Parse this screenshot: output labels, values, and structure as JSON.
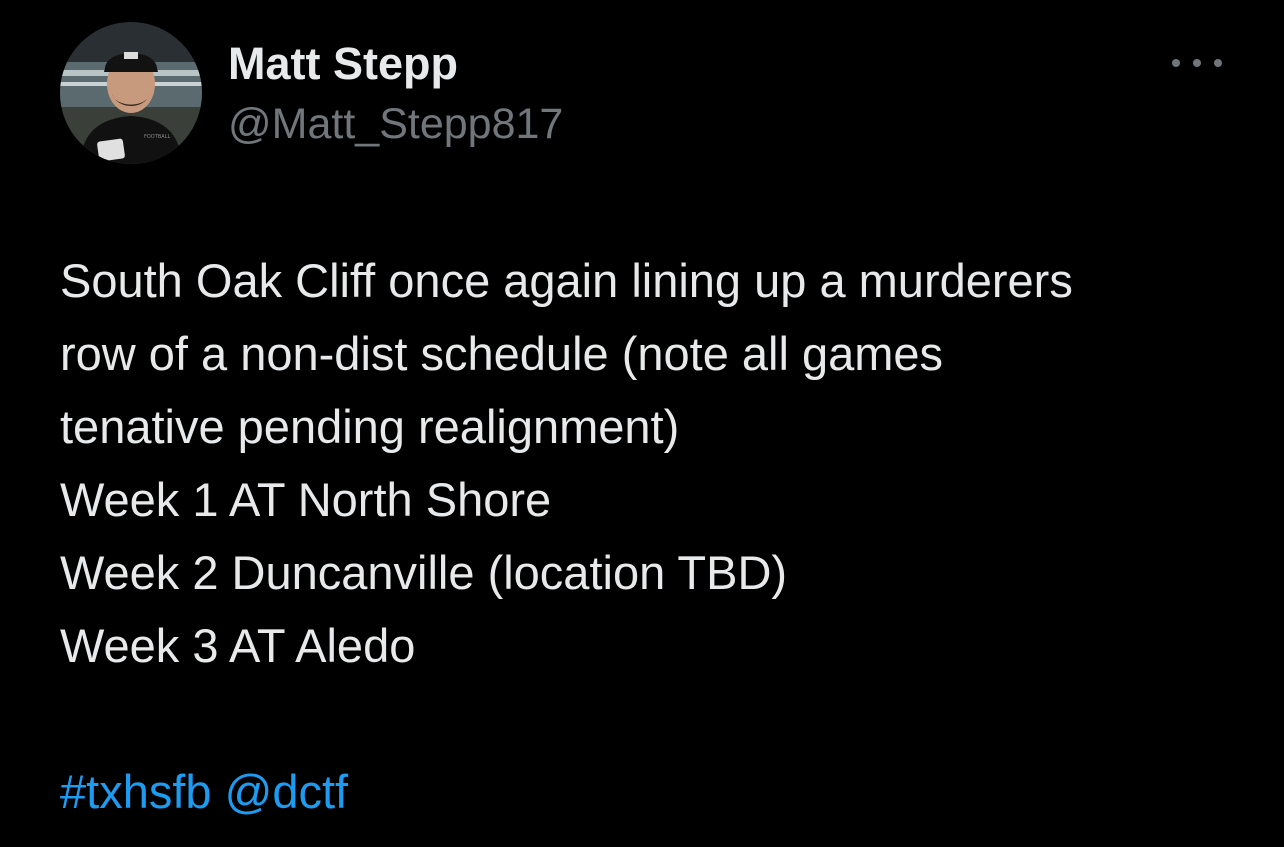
{
  "author": {
    "display_name": "Matt Stepp",
    "handle": "@Matt_Stepp817",
    "avatar_icon": "profile-photo"
  },
  "more_icon": "more-horizontal-icon",
  "tweet": {
    "lines": [
      "South Oak Cliff once again lining up a murderers",
      "row of a non-dist schedule (note all games",
      "tenative pending realignment)",
      "Week 1 AT North Shore",
      "Week 2 Duncanville (location TBD)",
      "Week 3 AT Aledo"
    ],
    "hashtag": "#txhsfb",
    "mention": "@dctf"
  },
  "colors": {
    "background": "#000000",
    "primary_text": "#e7e9ea",
    "secondary_text": "#71767b",
    "link": "#1d9bf0"
  }
}
